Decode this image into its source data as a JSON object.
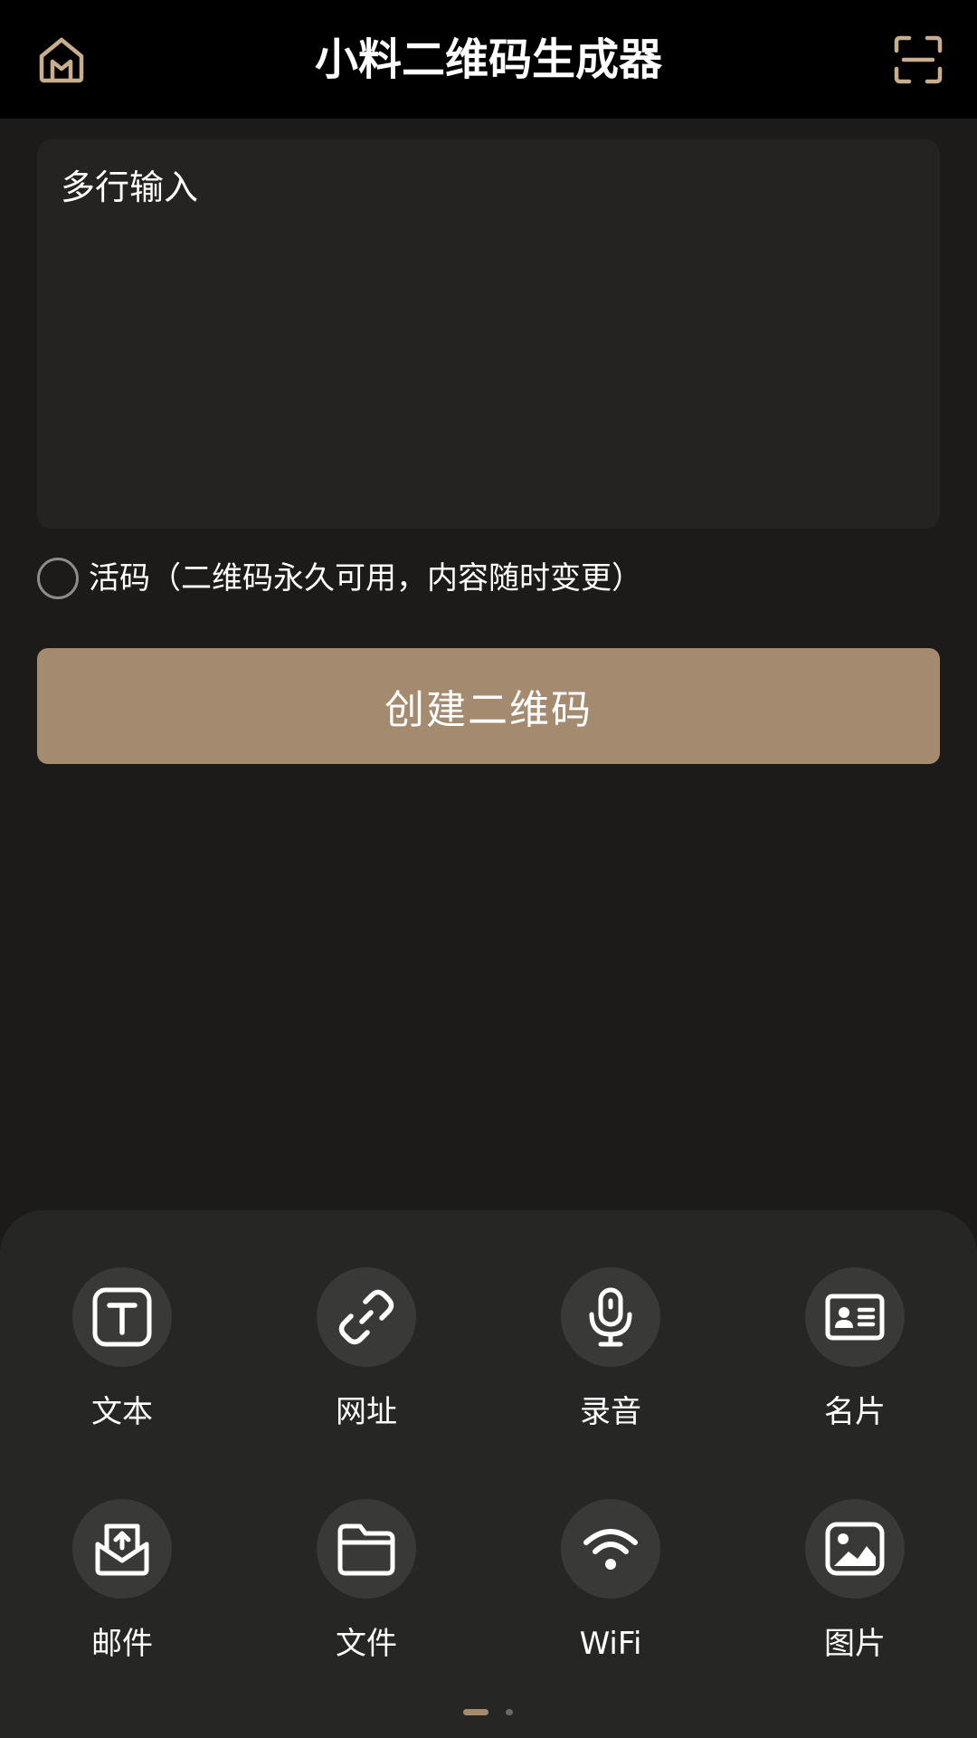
{
  "header": {
    "title": "小料二维码生成器",
    "home_icon": "home-icon",
    "scan_icon": "scan-icon"
  },
  "input": {
    "placeholder": "多行输入",
    "value": ""
  },
  "live_code": {
    "label": "活码（二维码永久可用，内容随时变更）",
    "checked": false
  },
  "create_button": {
    "label": "创建二维码"
  },
  "types": [
    {
      "label": "文本",
      "icon": "text-icon"
    },
    {
      "label": "网址",
      "icon": "link-icon"
    },
    {
      "label": "录音",
      "icon": "microphone-icon"
    },
    {
      "label": "名片",
      "icon": "business-card-icon"
    },
    {
      "label": "邮件",
      "icon": "mail-icon"
    },
    {
      "label": "文件",
      "icon": "folder-icon"
    },
    {
      "label": "WiFi",
      "icon": "wifi-icon"
    },
    {
      "label": "图片",
      "icon": "image-icon"
    }
  ],
  "pager": {
    "current": 1,
    "total": 2
  },
  "colors": {
    "accent": "#a48b6f",
    "background": "#1c1b19",
    "panel": "#262625",
    "topbar": "#000000"
  }
}
